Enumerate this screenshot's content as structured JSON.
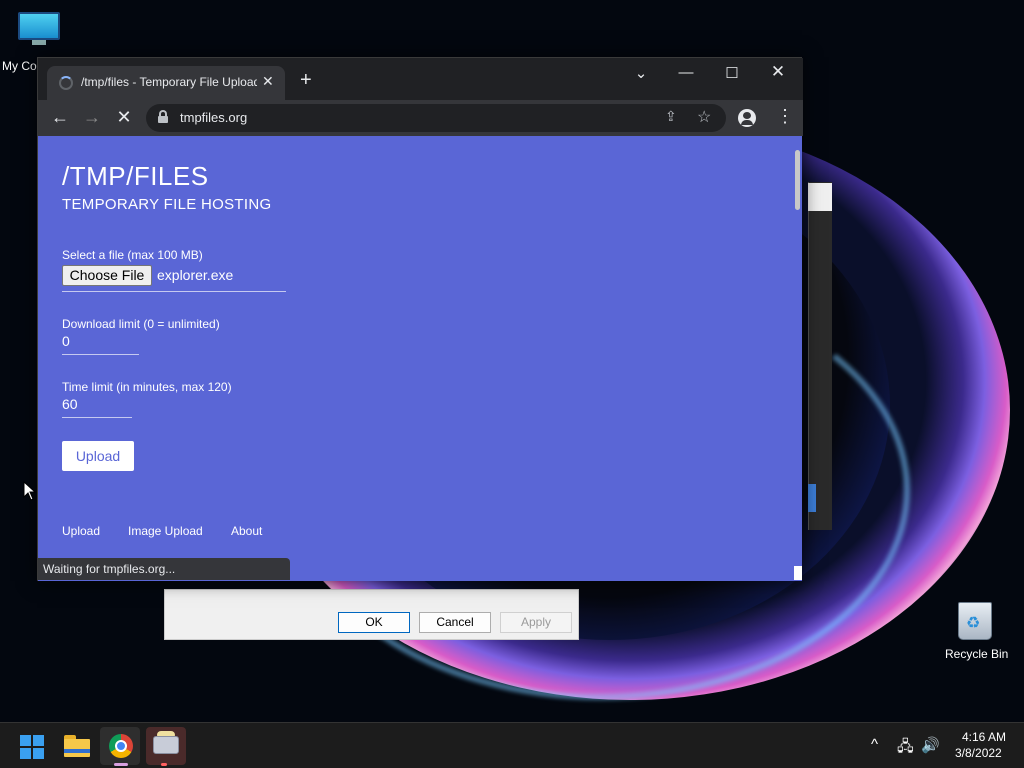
{
  "desktop": {
    "my_computer_label": "My Co",
    "recycle_bin_label": "Recycle Bin"
  },
  "background_dialog": {
    "ok_label": "OK",
    "cancel_label": "Cancel",
    "apply_label": "Apply"
  },
  "browser": {
    "tab_title": "/tmp/files - Temporary File Upload",
    "tab_close": "✕",
    "new_tab": "+",
    "tab_search": "⌄",
    "minimize": "—",
    "maximize": "☐",
    "close": "✕",
    "url": "tmpfiles.org",
    "status_text": "Waiting for tmpfiles.org..."
  },
  "page": {
    "title": "/TMP/FILES",
    "subtitle": "TEMPORARY FILE HOSTING",
    "file_label": "Select a file (max 100 MB)",
    "choose_file_label": "Choose File",
    "file_name": "explorer.exe",
    "download_limit_label": "Download limit (0 = unlimited)",
    "download_limit_value": "0",
    "time_limit_label": "Time limit (in minutes, max 120)",
    "time_limit_value": "60",
    "upload_button": "Upload",
    "footer_links": [
      "Upload",
      "Image Upload",
      "About"
    ]
  },
  "taskbar": {
    "time": "4:16 AM",
    "date": "3/8/2022",
    "tray_chevron": "^",
    "apps": [
      "start",
      "file-explorer",
      "chrome",
      "keyboard-app"
    ]
  },
  "colors": {
    "page_background": "#5a66d6",
    "browser_frame": "#202124",
    "toolbar": "#35363a"
  }
}
